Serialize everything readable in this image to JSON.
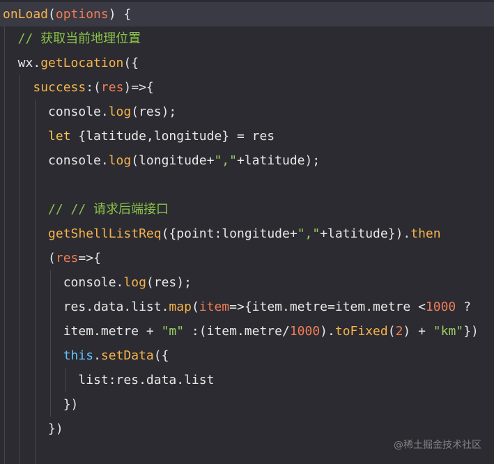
{
  "colors": {
    "background": "#2b2b31",
    "current_line": "#3a3a44",
    "indent_guide": "#474752",
    "plain": "#e8e8e8",
    "keyword": "#f9c74f",
    "function": "#f7b34b",
    "param": "#ef7d57",
    "comment": "#8bc34a",
    "string": "#9ccc65",
    "number": "#ef7d57",
    "brace": "#e8e8e8",
    "this": "#66c2ff"
  },
  "code_lines": [
    [
      {
        "t": "onLoad",
        "c": "function"
      },
      {
        "t": "(",
        "c": "plain"
      },
      {
        "t": "options",
        "c": "param"
      },
      {
        "t": ") {",
        "c": "plain"
      }
    ],
    [
      {
        "t": "  // 获取当前地理位置",
        "c": "comment"
      }
    ],
    [
      {
        "t": "  wx.",
        "c": "plain"
      },
      {
        "t": "getLocation",
        "c": "function"
      },
      {
        "t": "({",
        "c": "plain"
      }
    ],
    [
      {
        "t": "    ",
        "c": "plain"
      },
      {
        "t": "success",
        "c": "function"
      },
      {
        "t": ":(",
        "c": "plain"
      },
      {
        "t": "res",
        "c": "param"
      },
      {
        "t": ")=>{",
        "c": "plain"
      }
    ],
    [
      {
        "t": "      console.",
        "c": "plain"
      },
      {
        "t": "log",
        "c": "function"
      },
      {
        "t": "(res);",
        "c": "plain"
      }
    ],
    [
      {
        "t": "      ",
        "c": "plain"
      },
      {
        "t": "let",
        "c": "keyword"
      },
      {
        "t": " {latitude,longitude} = res",
        "c": "plain"
      }
    ],
    [
      {
        "t": "      console.",
        "c": "plain"
      },
      {
        "t": "log",
        "c": "function"
      },
      {
        "t": "(longitude+",
        "c": "plain"
      },
      {
        "t": "\",\"",
        "c": "string"
      },
      {
        "t": "+latitude);",
        "c": "plain"
      }
    ],
    [
      {
        "t": "",
        "c": "plain"
      }
    ],
    [
      {
        "t": "      // // 请求后端接口",
        "c": "comment"
      }
    ],
    [
      {
        "t": "      ",
        "c": "plain"
      },
      {
        "t": "getShellListReq",
        "c": "function"
      },
      {
        "t": "({",
        "c": "plain"
      },
      {
        "t": "point",
        "c": "plain"
      },
      {
        "t": ":longitude+",
        "c": "plain"
      },
      {
        "t": "\",\"",
        "c": "string"
      },
      {
        "t": "+latitude}).",
        "c": "plain"
      },
      {
        "t": "then",
        "c": "function"
      }
    ],
    [
      {
        "t": "      (",
        "c": "plain"
      },
      {
        "t": "res",
        "c": "param"
      },
      {
        "t": "=>{",
        "c": "plain"
      }
    ],
    [
      {
        "t": "        console.",
        "c": "plain"
      },
      {
        "t": "log",
        "c": "function"
      },
      {
        "t": "(res);",
        "c": "plain"
      }
    ],
    [
      {
        "t": "        res.data.list.",
        "c": "plain"
      },
      {
        "t": "map",
        "c": "function"
      },
      {
        "t": "(",
        "c": "plain"
      },
      {
        "t": "item",
        "c": "param"
      },
      {
        "t": "=>{item.metre=item.metre <",
        "c": "plain"
      },
      {
        "t": "1000",
        "c": "number"
      },
      {
        "t": " ?",
        "c": "plain"
      }
    ],
    [
      {
        "t": "        item.metre + ",
        "c": "plain"
      },
      {
        "t": "\"m\"",
        "c": "string"
      },
      {
        "t": " :(item.metre/",
        "c": "plain"
      },
      {
        "t": "1000",
        "c": "number"
      },
      {
        "t": ").",
        "c": "plain"
      },
      {
        "t": "toFixed",
        "c": "function"
      },
      {
        "t": "(",
        "c": "plain"
      },
      {
        "t": "2",
        "c": "number"
      },
      {
        "t": ") + ",
        "c": "plain"
      },
      {
        "t": "\"km\"",
        "c": "string"
      },
      {
        "t": "})",
        "c": "plain"
      }
    ],
    [
      {
        "t": "        ",
        "c": "plain"
      },
      {
        "t": "this",
        "c": "this"
      },
      {
        "t": ".",
        "c": "plain"
      },
      {
        "t": "setData",
        "c": "function"
      },
      {
        "t": "({",
        "c": "plain"
      }
    ],
    [
      {
        "t": "          list:res.data.list",
        "c": "plain"
      }
    ],
    [
      {
        "t": "        })",
        "c": "plain"
      }
    ],
    [
      {
        "t": "      })",
        "c": "plain"
      }
    ]
  ],
  "watermark": "@稀土掘金技术社区"
}
